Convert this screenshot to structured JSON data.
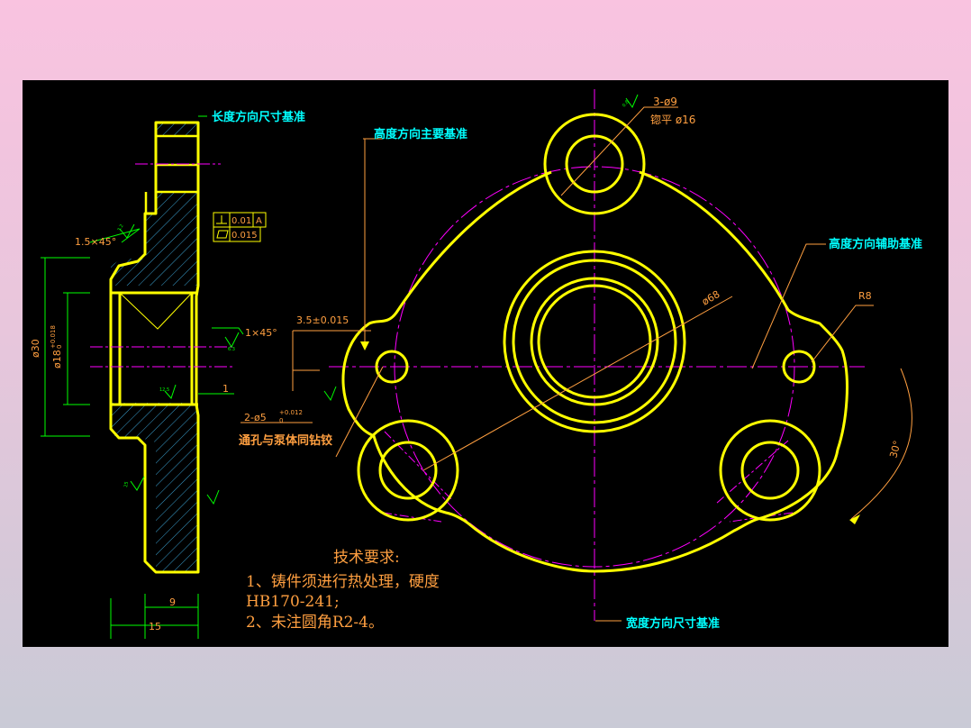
{
  "datum_labels": {
    "length_datum": "长度方向尺寸基准",
    "height_main_datum": "高度方向主要基准",
    "height_aux_datum": "高度方向辅助基准",
    "width_datum": "宽度方向尺寸基准"
  },
  "dimensions": {
    "holes_3x": "3-ø9",
    "counterbore": "锪平 ø16",
    "dia_68": "ø68",
    "radius_8": "R8",
    "angle_30": "30°",
    "pos_3_5": "3.5±0.015",
    "pin_holes": "2-ø5",
    "pin_tol_upper": "+0.012",
    "pin_tol_lower": "0",
    "pin_note": "通孔与泵体同钻铰",
    "chamfer_1": "1.5×45°",
    "chamfer_2": "1×45°",
    "dia_30": "ø30",
    "dia_18": "ø18",
    "dia_18_tol_upper": "+0.018",
    "dia_18_tol_lower": "0",
    "dim_1": "1",
    "dim_9": "9",
    "dim_15": "15",
    "perp_tol": "0.01",
    "perp_datum": "A",
    "flat_tol": "0.015",
    "rough_a": "3.2",
    "rough_b": "6.3",
    "rough_c": "12.5",
    "rough_d": "25",
    "rough_e": "0.8"
  },
  "tech_requirements": {
    "title": "技术要求:",
    "line1": "1、铸件须进行热处理，硬度",
    "line2": "HB170-241;",
    "line3": "2、未注圆角R2-4。"
  },
  "colors": {
    "outline": "#ffff00",
    "centerline": "#ff00ff",
    "hatch": "#3aa0d0",
    "dimension": "#00ff00",
    "label_cyan": "#00ffff",
    "label_orange": "#ff9f40",
    "background": "#000000"
  }
}
